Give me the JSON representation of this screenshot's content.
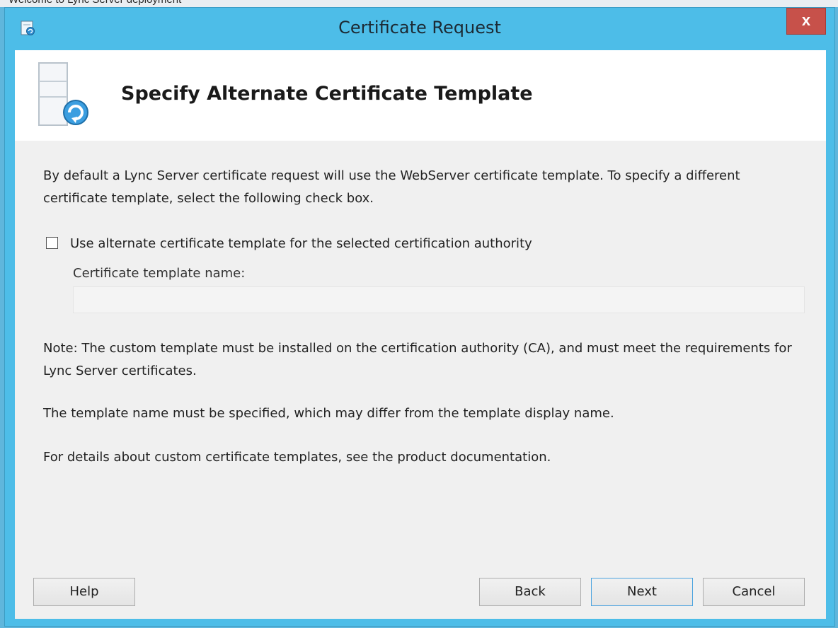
{
  "background_text": "Welcome to Lync Server deployment",
  "window": {
    "title": "Certificate Request",
    "close_label": "x",
    "icons": {
      "app": "app-refresh-icon",
      "close": "close-icon",
      "header": "server-certificate-icon"
    }
  },
  "header": {
    "title": "Specify Alternate Certificate Template"
  },
  "content": {
    "intro": "By default a Lync Server certificate request will use the WebServer certificate template. To specify a different certificate template, select the following check box.",
    "checkbox": {
      "label": "Use alternate certificate template for the selected certification authority",
      "checked": false
    },
    "template_name": {
      "label": "Certificate template name:",
      "value": "",
      "placeholder": ""
    },
    "note1": "Note: The custom template must be installed on the certification authority (CA), and must meet the requirements for Lync Server certificates.",
    "note2": "The template name must be specified, which may differ from the template display name.",
    "note3": "For details about custom certificate templates, see the product documentation."
  },
  "buttons": {
    "help": "Help",
    "back": "Back",
    "next": "Next",
    "cancel": "Cancel"
  },
  "colors": {
    "window_frame": "#4dbde8",
    "close_button": "#c7514a",
    "content_bg": "#f0f0f0",
    "header_bg": "#ffffff"
  }
}
